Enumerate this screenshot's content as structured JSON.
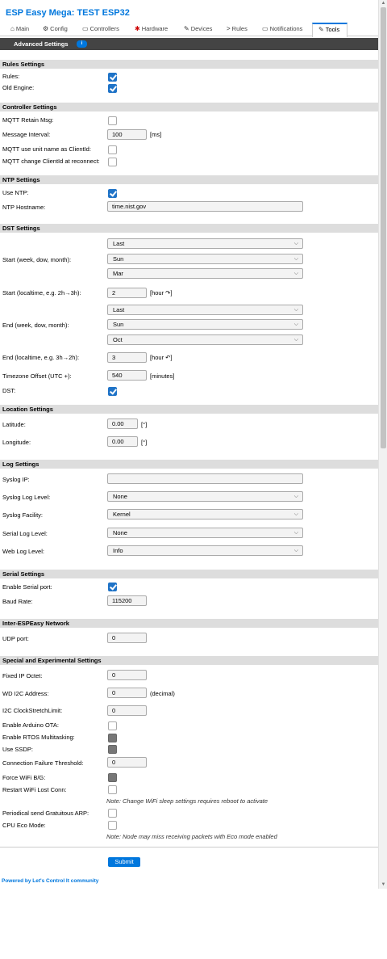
{
  "app": {
    "title": "ESP Easy Mega: TEST ESP32"
  },
  "tabs": [
    {
      "label": "Main",
      "icon": "home-icon"
    },
    {
      "label": "Config",
      "icon": "gear-icon"
    },
    {
      "label": "Controllers",
      "icon": "chat-icon"
    },
    {
      "label": "Hardware",
      "icon": "pin-icon"
    },
    {
      "label": "Devices",
      "icon": "plug-icon"
    },
    {
      "label": "Rules",
      "icon": "arrow-icon"
    },
    {
      "label": "Notifications",
      "icon": "envelope-icon"
    },
    {
      "label": "Tools",
      "icon": "wrench-icon"
    }
  ],
  "icons": {
    "info": "i",
    "chevron": "⌵"
  },
  "header": {
    "title": "Advanced Settings"
  },
  "sections": {
    "rules": "Rules Settings",
    "controller": "Controller Settings",
    "ntp": "NTP Settings",
    "dst": "DST Settings",
    "location": "Location Settings",
    "log": "Log Settings",
    "serial": "Serial Settings",
    "inter": "Inter-ESPEasy Network",
    "special": "Special and Experimental Settings"
  },
  "rules": {
    "rules_label": "Rules:",
    "old_engine_label": "Old Engine:"
  },
  "controller": {
    "retain_label": "MQTT Retain Msg:",
    "interval_label": "Message Interval:",
    "interval_value": "100",
    "interval_unit": "[ms]",
    "unit_name_label": "MQTT use unit name as ClientId:",
    "change_client_label": "MQTT change ClientId at reconnect:"
  },
  "ntp": {
    "use_label": "Use NTP:",
    "host_label": "NTP Hostname:",
    "host_value": "time.nist.gov"
  },
  "dst": {
    "start_label": "Start (week, dow, month):",
    "start_week": "Last",
    "start_dow": "Sun",
    "start_month": "Mar",
    "start_time_label": "Start (localtime, e.g. 2h→3h):",
    "start_time_value": "2",
    "start_time_unit": "[hour ↷]",
    "end_label": "End (week, dow, month):",
    "end_week": "Last",
    "end_dow": "Sun",
    "end_month": "Oct",
    "end_time_label": "End (localtime, e.g. 3h→2h):",
    "end_time_value": "3",
    "end_time_unit": "[hour ↶]",
    "tz_label": "Timezone Offset (UTC +):",
    "tz_value": "540",
    "tz_unit": "[minutes]",
    "dst_label": "DST:"
  },
  "location": {
    "lat_label": "Latitude:",
    "lat_value": "0.00",
    "lat_unit": "[°]",
    "lon_label": "Longitude:",
    "lon_value": "0.00",
    "lon_unit": "[°]"
  },
  "log": {
    "syslog_ip_label": "Syslog IP:",
    "syslog_ip_value": "",
    "syslog_level_label": "Syslog Log Level:",
    "syslog_level_value": "None",
    "facility_label": "Syslog Facility:",
    "facility_value": "Kernel",
    "serial_level_label": "Serial Log Level:",
    "serial_level_value": "None",
    "web_level_label": "Web Log Level:",
    "web_level_value": "Info"
  },
  "serial": {
    "enable_label": "Enable Serial port:",
    "baud_label": "Baud Rate:",
    "baud_value": "115200"
  },
  "inter": {
    "udp_label": "UDP port:",
    "udp_value": "0"
  },
  "special": {
    "fixed_ip_label": "Fixed IP Octet:",
    "fixed_ip_value": "0",
    "wd_label": "WD I2C Address:",
    "wd_value": "0",
    "wd_unit": "(decimal)",
    "stretch_label": "I2C ClockStretchLimit:",
    "stretch_value": "0",
    "ota_label": "Enable Arduino OTA:",
    "rtos_label": "Enable RTOS Multitasking:",
    "ssdp_label": "Use SSDP:",
    "threshold_label": "Connection Failure Threshold:",
    "threshold_value": "0",
    "force_label": "Force WiFi B/G:",
    "restart_label": "Restart WiFi Lost Conn:",
    "wifi_note": "Note: Change WiFi sleep settings requires reboot to activate",
    "arp_label": "Periodical send Gratuitous ARP:",
    "eco_label": "CPU Eco Mode:",
    "eco_note": "Note: Node may miss receiving packets with Eco mode enabled"
  },
  "submit_label": "Submit",
  "footer": {
    "prefix": "Powered by ",
    "brand": "Let's Control It",
    "suffix": " community"
  }
}
